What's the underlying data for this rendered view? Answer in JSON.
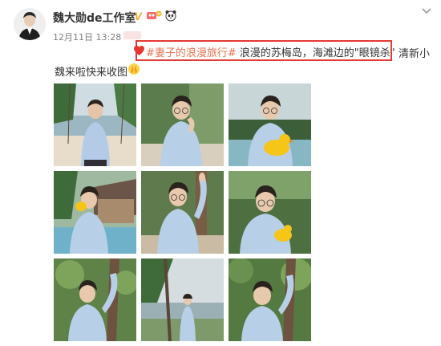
{
  "header": {
    "username": "魏大勋de工作室",
    "verified_mark": "V",
    "timestamp": "12月11日 13:28",
    "menu_icon": "chevron-down-icon"
  },
  "post": {
    "hashtag": "#妻子的浪漫旅行#",
    "body_part1": "浪漫的苏梅岛，海滩边的\"眼镜杀\"",
    "body_part1b": "清新小",
    "body_part2": "魏来啦快来收图",
    "emoji_heart": "heart-icon",
    "emoji_pray": "pray-hands-icon"
  },
  "photos": [
    {
      "id": "photo-1",
      "scene": "man in light blue shirt on rope swing, palm trees and sea behind"
    },
    {
      "id": "photo-2",
      "scene": "man in glasses hand at chin, tropical greenery"
    },
    {
      "id": "photo-3",
      "scene": "man in glasses holding yellow rubber duck by pool"
    },
    {
      "id": "photo-4",
      "scene": "man by pool holding yellow duck to ear, villa behind"
    },
    {
      "id": "photo-5",
      "scene": "man in glasses hand raised on wooden post"
    },
    {
      "id": "photo-6",
      "scene": "man in glasses holding yellow duck, smiling"
    },
    {
      "id": "photo-7",
      "scene": "man hand raised against tree trunk, leaves"
    },
    {
      "id": "photo-8",
      "scene": "man standing on beach under palm tree, distant"
    },
    {
      "id": "photo-9",
      "scene": "man hand raised on tree, green leaves around"
    }
  ],
  "colors": {
    "hashtag": "#eb7350",
    "verified": "#f5a623",
    "highlight_box": "#e53935",
    "shirt": "#a9c4e2"
  }
}
